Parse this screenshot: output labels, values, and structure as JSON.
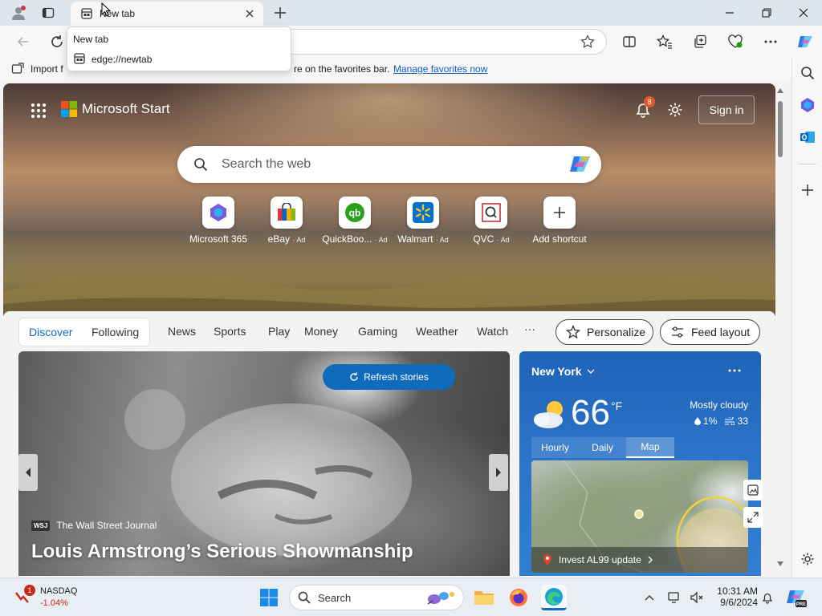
{
  "browser": {
    "tab_title": "New tab",
    "tooltip_title": "New tab",
    "tooltip_url": "edge://newtab",
    "favorites_text": "Import f… re on the favorites bar.",
    "favorites_prefix": "Import f",
    "favorites_suffix": "re on the favorites bar.",
    "manage_favorites": "Manage favorites now"
  },
  "header": {
    "brand": "Microsoft Start",
    "notification_count": "8",
    "sign_in": "Sign in"
  },
  "search": {
    "placeholder": "Search the web"
  },
  "shortcuts": [
    {
      "label": "Microsoft 365",
      "ad": ""
    },
    {
      "label": "eBay",
      "ad": "· Ad"
    },
    {
      "label": "QuickBoo...",
      "ad": "· Ad"
    },
    {
      "label": "Walmart",
      "ad": "· Ad"
    },
    {
      "label": "QVC",
      "ad": "· Ad"
    },
    {
      "label": "Add shortcut",
      "ad": ""
    }
  ],
  "feed": {
    "tabs": [
      "Discover",
      "Following"
    ],
    "categories": [
      "News",
      "Sports",
      "Play",
      "Money",
      "Gaming",
      "Weather",
      "Watch"
    ],
    "more": "···",
    "personalize": "Personalize",
    "feed_layout": "Feed layout"
  },
  "story": {
    "refresh": "Refresh stories",
    "source_badge": "WSJ",
    "source": "The Wall Street Journal",
    "title": "Louis Armstrong’s Serious Showmanship"
  },
  "weather": {
    "location": "New York",
    "temp": "66",
    "unit": "°F",
    "condition": "Mostly cloudy",
    "precip": "1%",
    "wind": "33",
    "tabs": [
      "Hourly",
      "Daily",
      "Map"
    ],
    "active_tab": "Map",
    "map_banner": "Invest AL99 update"
  },
  "taskbar": {
    "stock_name": "NASDAQ",
    "stock_change": "-1.04%",
    "stock_badge": "1",
    "search": "Search",
    "time": "10:31 AM",
    "date": "9/6/2024"
  },
  "colors": {
    "accent": "#0f6cbd",
    "link": "#0f5bbd",
    "weather_bg": "#2b74c9",
    "stock_negative": "#c42b1c"
  }
}
